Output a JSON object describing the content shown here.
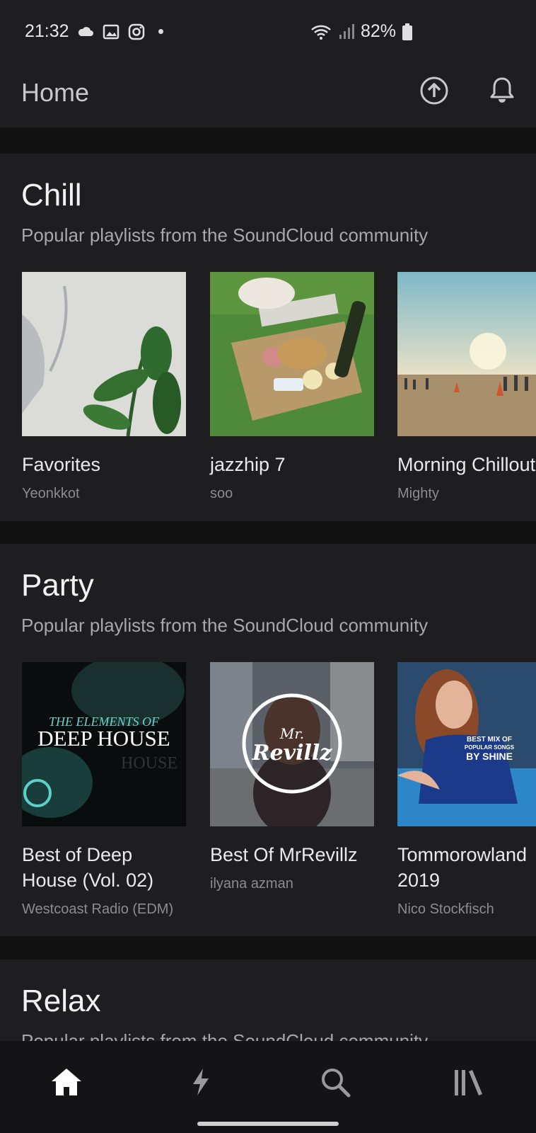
{
  "status_bar": {
    "time": "21:32",
    "battery": "82%",
    "icons": [
      "cloud-icon",
      "image-icon",
      "instagram-icon",
      "dot-icon",
      "wifi-icon",
      "signal-icon",
      "battery-icon"
    ]
  },
  "header": {
    "title": "Home",
    "upload_icon": "upload-icon",
    "notifications_icon": "bell-icon"
  },
  "sections": [
    {
      "title": "Chill",
      "subtitle": "Popular playlists from the SoundCloud community",
      "playlists": [
        {
          "title": "Favorites",
          "user": "Yeonkkot"
        },
        {
          "title": "jazzhip 7",
          "user": "soo"
        },
        {
          "title": "Morning Chillout",
          "user": "Mighty"
        }
      ]
    },
    {
      "title": "Party",
      "subtitle": "Popular playlists from the SoundCloud community",
      "playlists": [
        {
          "title": "Best of Deep House (Vol. 02)",
          "user": "Westcoast Radio (EDM)",
          "art_text": "THE ELEMENTS OF DEEP HOUSE"
        },
        {
          "title": "Best Of MrRevillz",
          "user": "ilyana azman",
          "art_text": "Mr. Revillz"
        },
        {
          "title": "Tommorowland 2019",
          "user": "Nico Stockfisch",
          "art_text": "BEST MIX OF POPULAR SONGS BY SHINE"
        }
      ]
    },
    {
      "title": "Relax",
      "subtitle": "Popular playlists from the SoundCloud community"
    }
  ],
  "bottom_nav": {
    "items": [
      "home-icon",
      "stream-icon",
      "search-icon",
      "library-icon"
    ],
    "active": "home-icon"
  }
}
